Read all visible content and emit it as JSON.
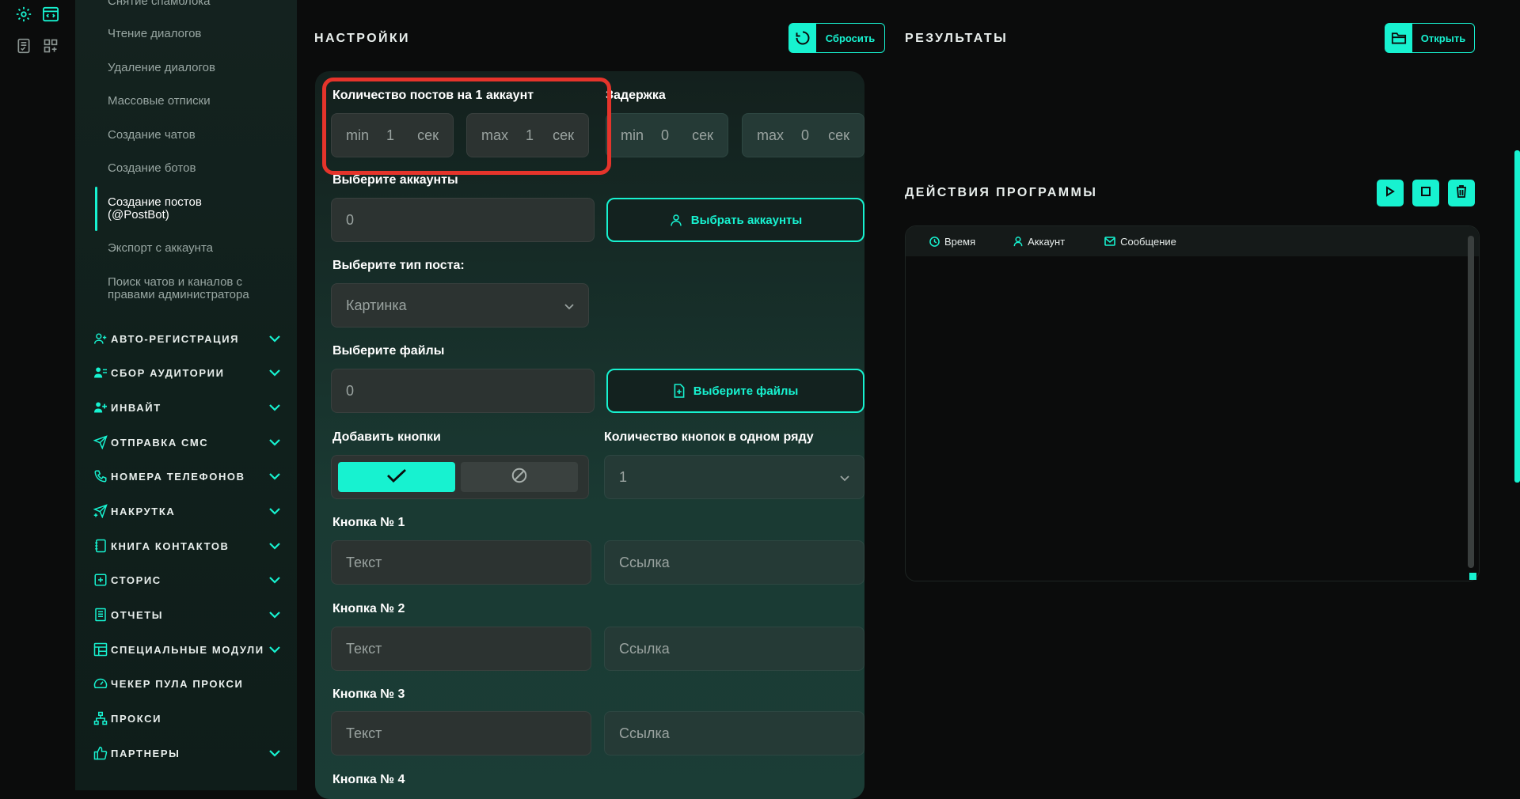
{
  "rail": {
    "icons": [
      "settings-gear-icon",
      "code-window-icon",
      "task-list-icon",
      "layout-grid-icon"
    ]
  },
  "sidebar": {
    "top_items": [
      {
        "label": "Снятие спамблока",
        "active": false
      },
      {
        "label": "Чтение диалогов",
        "active": false
      },
      {
        "label": "Удаление диалогов",
        "active": false
      },
      {
        "label": "Массовые отписки",
        "active": false
      },
      {
        "label": "Создание чатов",
        "active": false
      },
      {
        "label": "Создание ботов",
        "active": false
      },
      {
        "label": "Создание постов (@PostBot)",
        "active": true
      },
      {
        "label": "Экспорт с аккаунта",
        "active": false
      },
      {
        "label": "Поиск чатов и каналов с правами администратора",
        "active": false
      }
    ],
    "sections": [
      {
        "label": "Авто-регистрация",
        "icon": "user-plus-icon",
        "chevron": true
      },
      {
        "label": "Сбор аудитории",
        "icon": "users-icon",
        "chevron": true
      },
      {
        "label": "Инвайт",
        "icon": "user-add-icon",
        "chevron": true
      },
      {
        "label": "Отправка смс",
        "icon": "send-icon",
        "chevron": true
      },
      {
        "label": "Номера телефонов",
        "icon": "phone-icon",
        "chevron": true
      },
      {
        "label": "Накрутка",
        "icon": "send-plus-icon",
        "chevron": true
      },
      {
        "label": "Книга контактов",
        "icon": "contacts-book-icon",
        "chevron": true
      },
      {
        "label": "Сторис",
        "icon": "story-plus-icon",
        "chevron": true
      },
      {
        "label": "Отчеты",
        "icon": "report-icon",
        "chevron": true
      },
      {
        "label": "Специальные модули",
        "icon": "modules-icon",
        "chevron": true
      },
      {
        "label": "Чекер пула прокси",
        "icon": "speedometer-icon",
        "chevron": false
      },
      {
        "label": "Прокси",
        "icon": "network-icon",
        "chevron": false
      },
      {
        "label": "Партнеры",
        "icon": "thumb-up-icon",
        "chevron": true
      }
    ]
  },
  "settings": {
    "title": "НАСТРОЙКИ",
    "reset_label": "Сбросить",
    "posts_count_label": "Количество постов на 1 аккаунт",
    "posts_min_prefix": "min",
    "posts_min_value": "1",
    "posts_max_prefix": "max",
    "posts_max_value": "1",
    "unit": "сек",
    "delay_label": "Задержка",
    "delay_min_value": "0",
    "delay_max_value": "0",
    "accounts_label": "Выберите аккаунты",
    "accounts_value": "0",
    "accounts_button": "Выбрать аккаунты",
    "post_type_label": "Выберите тип поста:",
    "post_type_value": "Картинка",
    "files_label": "Выберите файлы",
    "files_value": "0",
    "files_button": "Выберите файлы",
    "add_buttons_label": "Добавить кнопки",
    "buttons_per_row_label": "Количество кнопок в одном ряду",
    "buttons_per_row_value": "1",
    "button_rows": [
      {
        "label": "Кнопка № 1",
        "text_placeholder": "Текст",
        "link_placeholder": "Ссылка"
      },
      {
        "label": "Кнопка № 2",
        "text_placeholder": "Текст",
        "link_placeholder": "Ссылка"
      },
      {
        "label": "Кнопка № 3",
        "text_placeholder": "Текст",
        "link_placeholder": "Ссылка"
      }
    ],
    "button4_label": "Кнопка № 4"
  },
  "results": {
    "title": "РЕЗУЛЬТАТЫ",
    "open_label": "Открыть"
  },
  "actions": {
    "title": "ДЕЙСТВИЯ ПРОГРАММЫ",
    "columns": [
      {
        "label": "Время",
        "icon": "clock-icon"
      },
      {
        "label": "Аккаунт",
        "icon": "user-icon"
      },
      {
        "label": "Сообщение",
        "icon": "mail-icon"
      }
    ]
  },
  "colors": {
    "accent": "#17f2d0",
    "highlight": "#e5342b",
    "background": "#0b0c0c"
  }
}
